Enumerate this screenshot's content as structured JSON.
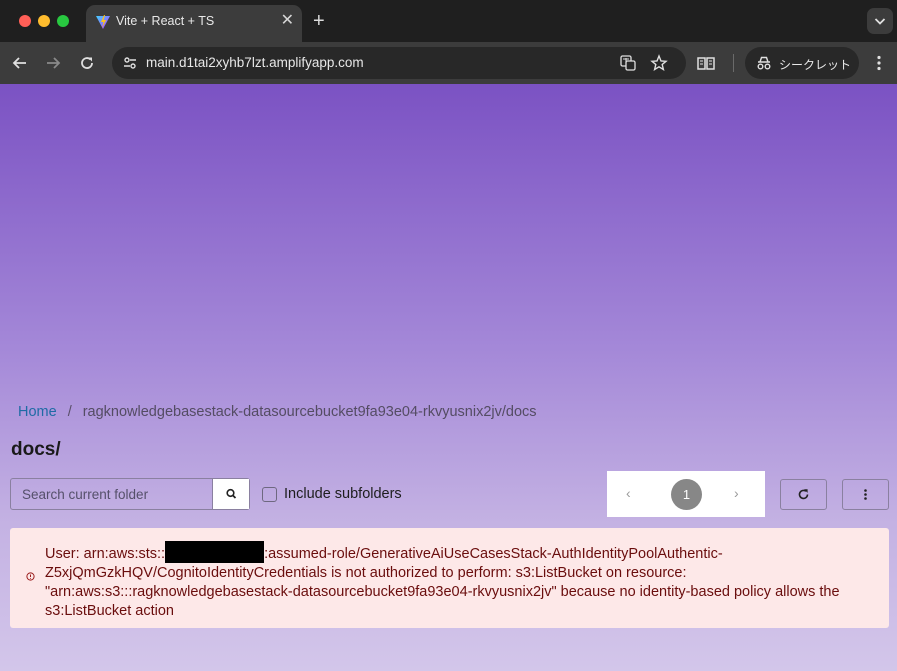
{
  "browser": {
    "tab_title": "Vite + React + TS",
    "tab_close_glyph": "✕",
    "new_tab_glyph": "+",
    "url": "main.d1tai2xyhb7lzt.amplifyapp.com",
    "incognito_label": "シークレット"
  },
  "breadcrumb": {
    "home": "Home",
    "separator": "/",
    "current": "ragknowledgebasestack-datasourcebucket9fa93e04-rkvyusnix2jv/docs"
  },
  "page_title": "docs/",
  "search": {
    "placeholder": "Search current folder",
    "value": ""
  },
  "include_subfolders": {
    "label": "Include subfolders",
    "checked": false
  },
  "pagination": {
    "prev": "‹",
    "next": "›",
    "current_page": "1"
  },
  "alert": {
    "text_before_redaction": "User: arn:aws:sts::",
    "text_after_redaction": ":assumed-role/GenerativeAiUseCasesStack-AuthIdentityPoolAuthentic-Z5xjQmGzkHQV/CognitoIdentityCredentials is not authorized to perform: s3:ListBucket on resource: \"arn:aws:s3:::ragknowledgebasestack-datasourcebucket9fa93e04-rkvyusnix2jv\" because no identity-based policy allows the s3:ListBucket action"
  },
  "colors": {
    "page_gradient_top": "#7b52c3",
    "page_gradient_bottom": "#d3c6ea",
    "link": "#1f6ba5",
    "alert_bg": "#fde8e8",
    "alert_text": "#6a0d0d"
  }
}
